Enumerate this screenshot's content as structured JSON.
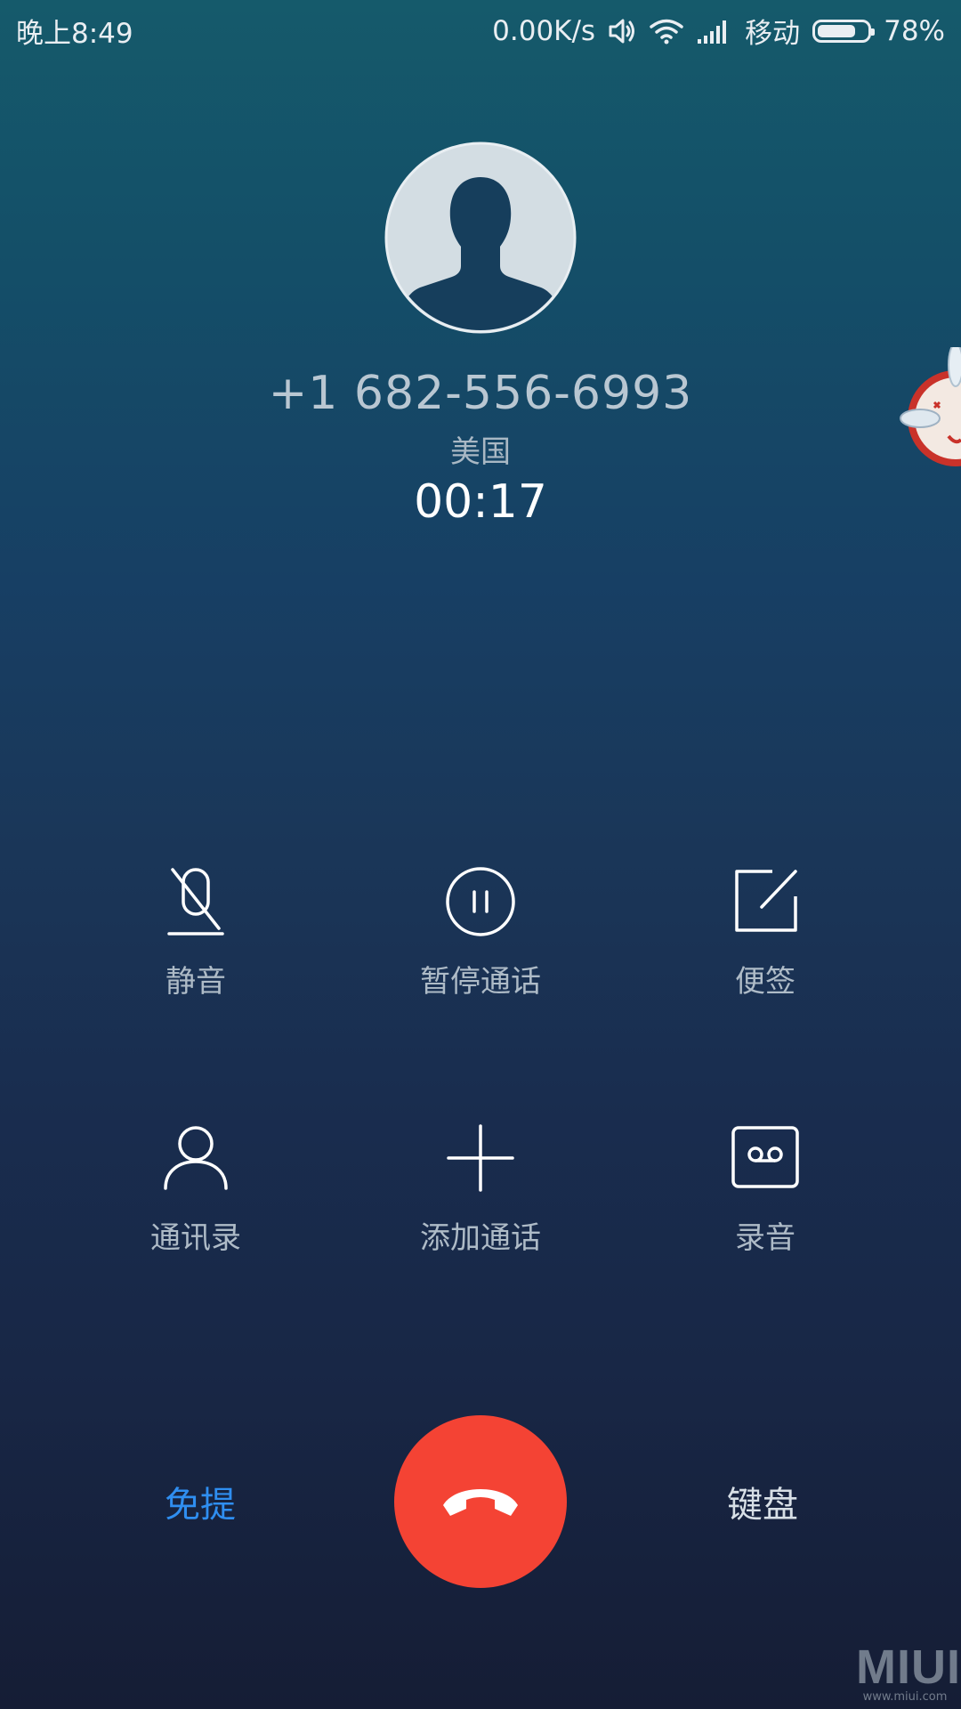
{
  "status_bar": {
    "time": "晚上8:49",
    "net_speed": "0.00K/s",
    "carrier": "移动",
    "battery_percent": "78%",
    "battery_level": 0.78,
    "icons": [
      "volume-icon",
      "wifi-icon",
      "signal-icon",
      "battery-icon"
    ]
  },
  "caller": {
    "number": "+1 682-556-6993",
    "location": "美国",
    "duration": "00:17"
  },
  "actions": [
    {
      "label": "静音",
      "icon": "mic-muted-icon"
    },
    {
      "label": "暂停通话",
      "icon": "pause-icon"
    },
    {
      "label": "便签",
      "icon": "note-icon"
    },
    {
      "label": "通讯录",
      "icon": "contact-icon"
    },
    {
      "label": "添加通话",
      "icon": "plus-icon"
    },
    {
      "label": "录音",
      "icon": "voicemail-record-icon"
    }
  ],
  "bottom": {
    "speaker_label": "免提",
    "keypad_label": "键盘",
    "end_call_icon": "hang-up-icon"
  },
  "watermark": {
    "logo": "MIUI",
    "url": "www.miui.com"
  },
  "colors": {
    "end_call": "#f44334",
    "speaker_active": "#2f8ef0",
    "bg_top": "#155a6b",
    "bg_bottom": "#151d35"
  }
}
